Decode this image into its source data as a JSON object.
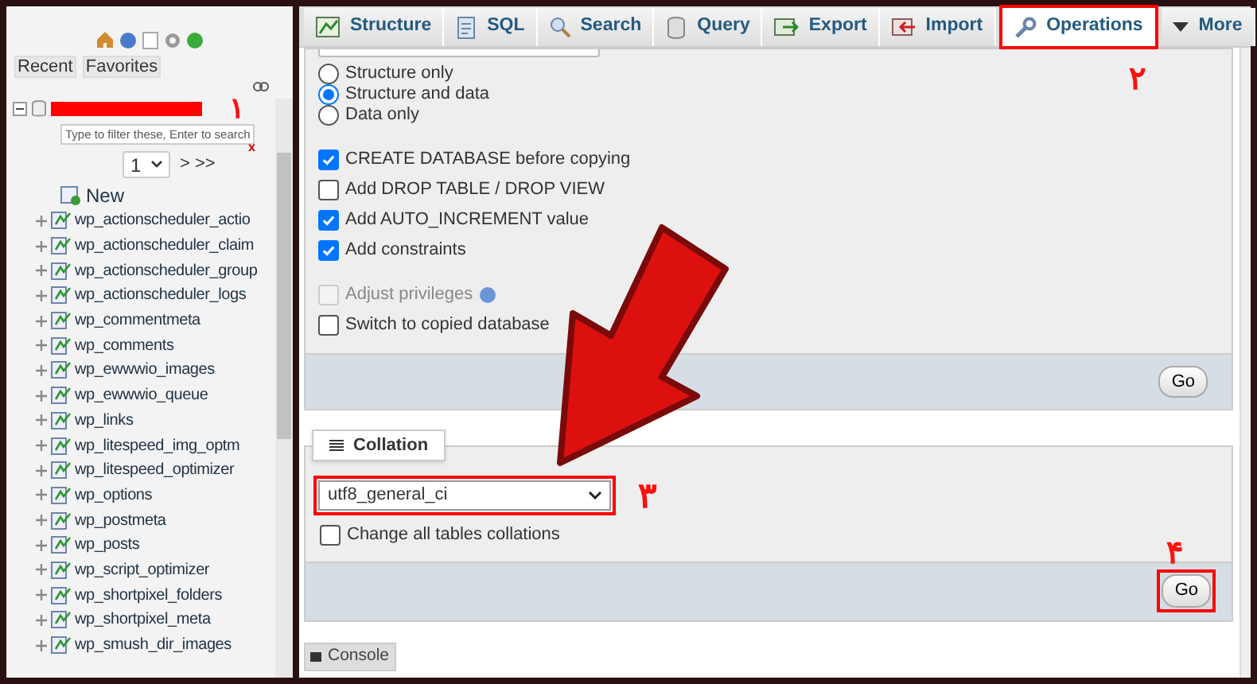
{
  "sidebar": {
    "tabs": [
      "Recent",
      "Favorites"
    ],
    "annotation": "۱",
    "filter": {
      "placeholder": "Type to filter these, Enter to search",
      "clear": "x"
    },
    "page": "1",
    "pager": "> >>",
    "new_item": "New",
    "tables": [
      "wp_actionscheduler_actio",
      "wp_actionscheduler_claim",
      "wp_actionscheduler_group",
      "wp_actionscheduler_logs",
      "wp_commentmeta",
      "wp_comments",
      "wp_ewwwio_images",
      "wp_ewwwio_queue",
      "wp_links",
      "wp_litespeed_img_optm",
      "wp_litespeed_optimizer",
      "wp_options",
      "wp_postmeta",
      "wp_posts",
      "wp_script_optimizer",
      "wp_shortpixel_folders",
      "wp_shortpixel_meta",
      "wp_smush_dir_images"
    ]
  },
  "tabs": [
    {
      "label": "Structure",
      "selected": false,
      "kind": "structure"
    },
    {
      "label": "SQL",
      "selected": false,
      "kind": "sql"
    },
    {
      "label": "Search",
      "selected": false,
      "kind": "search"
    },
    {
      "label": "Query",
      "selected": false,
      "kind": "query"
    },
    {
      "label": "Export",
      "selected": false,
      "kind": "export"
    },
    {
      "label": "Import",
      "selected": false,
      "kind": "import"
    },
    {
      "label": "Operations",
      "selected": true,
      "kind": "operations",
      "annotation": "۲"
    },
    {
      "label": "More",
      "selected": false,
      "kind": "more"
    }
  ],
  "copy": {
    "radios": [
      {
        "label": "Structure only",
        "selected": false
      },
      {
        "label": "Structure and data",
        "selected": true
      },
      {
        "label": "Data only",
        "selected": false
      }
    ],
    "options": [
      {
        "label": "CREATE DATABASE before copying",
        "checked": true
      },
      {
        "label": "Add DROP TABLE / DROP VIEW",
        "checked": false
      },
      {
        "label": "Add AUTO_INCREMENT value",
        "checked": true
      },
      {
        "label": "Add constraints",
        "checked": true
      }
    ],
    "extra": [
      {
        "label": "Adjust privileges",
        "checked": false,
        "disabled": true,
        "help": true
      },
      {
        "label": "Switch to copied database",
        "checked": false,
        "disabled": false,
        "help": false
      }
    ],
    "go": "Go"
  },
  "collation": {
    "legend": "Collation",
    "value": "utf8_general_ci",
    "annotation": "۳",
    "change_all": {
      "label": "Change all tables collations",
      "checked": false
    },
    "go": "Go",
    "go_annotation": "۴"
  },
  "console": "Console"
}
